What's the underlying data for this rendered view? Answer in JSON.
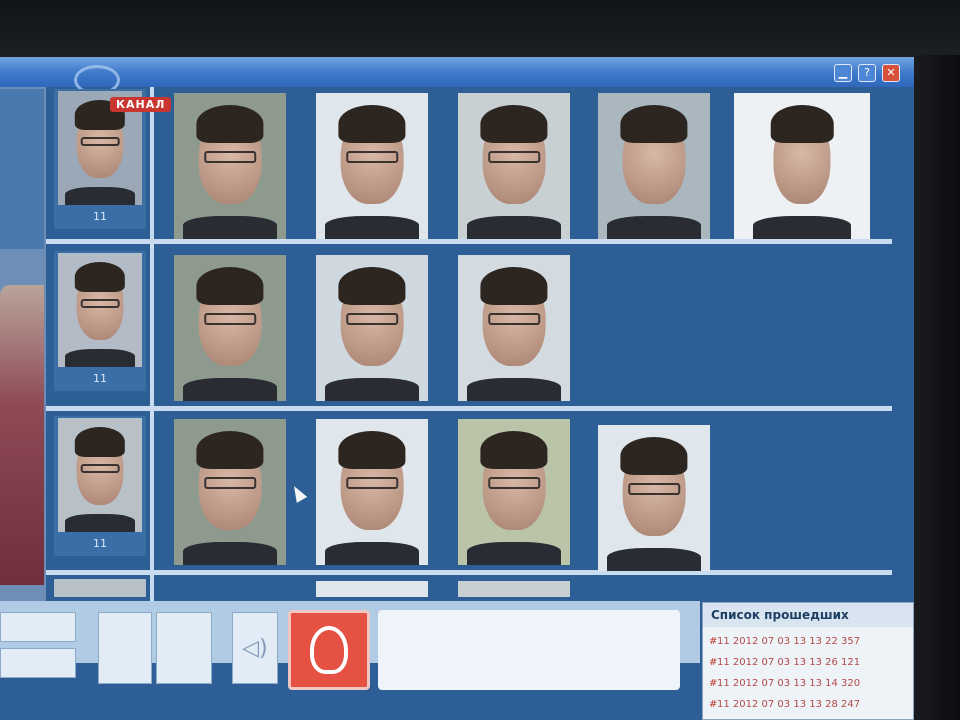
{
  "window": {
    "buttons": {
      "minimize": "▁",
      "help": "?",
      "close": "✕"
    }
  },
  "overlay": {
    "channel_logo": "КАНАЛ"
  },
  "grid": {
    "rows": [
      {
        "id_label": "11",
        "match_count": 5
      },
      {
        "id_label": "11",
        "match_count": 3
      },
      {
        "id_label": "11",
        "match_count": 4
      }
    ]
  },
  "passed_list": {
    "title": "Список прошедших",
    "rows": [
      "11 2012 07 03 13 13 22 357",
      "11 2012 07 03 13 13 26 121",
      "11 2012 07 03 13 13 14 320",
      "11 2012 07 03 13 13 28 247"
    ]
  },
  "icons": {
    "alarm": "alarm-icon",
    "sound": "speaker-icon"
  },
  "colors": {
    "screen_bg": "#2d5f96",
    "grid_line": "#c8dbef",
    "alarm": "#e55244",
    "titlebar": "#3e78c9"
  }
}
